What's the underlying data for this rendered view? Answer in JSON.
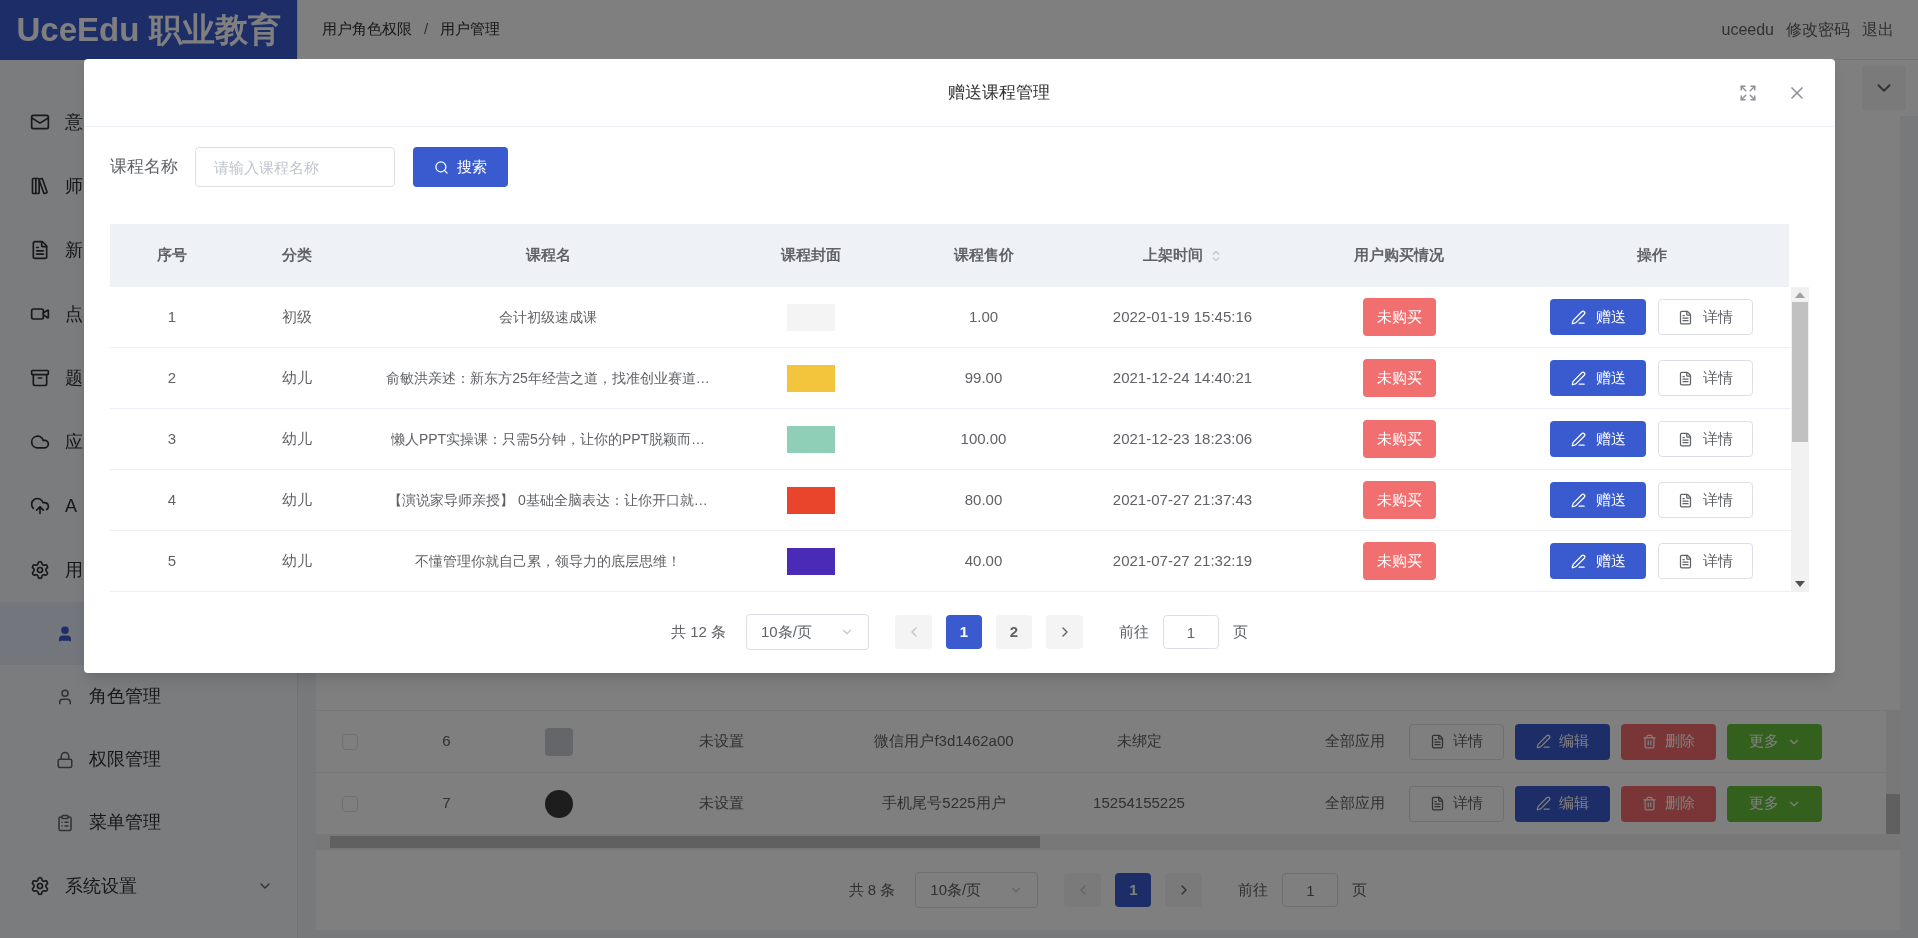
{
  "sidebar": {
    "logo": "UceEdu 职业教育",
    "items": [
      {
        "label": "意"
      },
      {
        "label": "师"
      },
      {
        "label": "新"
      },
      {
        "label": "点"
      },
      {
        "label": "题"
      },
      {
        "label": "应"
      },
      {
        "label": "A"
      },
      {
        "label": "用",
        "expanded": true,
        "children": [
          {
            "selected": true
          },
          {
            "label": "角色管理",
            "selected": false
          },
          {
            "label": "权限管理",
            "selected": false
          },
          {
            "label": "菜单管理",
            "selected": false
          }
        ]
      },
      {
        "label": "系统设置",
        "expanded": false
      }
    ]
  },
  "header": {
    "breadcrumb": [
      "用户角色权限",
      "用户管理"
    ],
    "separator": "/",
    "links": [
      "uceedu",
      "修改密码",
      "退出"
    ]
  },
  "user_table": {
    "rows": [
      {
        "checked": false,
        "index": "6",
        "role": "未设置",
        "nickname": "微信用户f3d1462a00",
        "phone": "未绑定",
        "app": "全部应用",
        "actions": [
          "详情",
          "编辑",
          "删除",
          "更多"
        ]
      },
      {
        "checked": false,
        "index": "7",
        "role": "未设置",
        "nickname": "手机尾号5225用户",
        "phone": "15254155225",
        "app": "全部应用",
        "actions": [
          "详情",
          "编辑",
          "删除",
          "更多"
        ]
      }
    ],
    "pagination": {
      "total": "共 8 条",
      "page_size": "10条/页",
      "pages": [
        {
          "label": "1",
          "selected": true
        }
      ],
      "goto_label": "前往",
      "goto_value": "1",
      "goto_suffix": "页"
    }
  },
  "modal": {
    "title": "赠送课程管理",
    "search": {
      "label": "课程名称",
      "placeholder": "请输入课程名称",
      "button": "搜索"
    },
    "table": {
      "columns": [
        {
          "label": "序号",
          "sortable": false
        },
        {
          "label": "分类",
          "sortable": false
        },
        {
          "label": "课程名",
          "sortable": false
        },
        {
          "label": "课程封面",
          "sortable": false
        },
        {
          "label": "课程售价",
          "sortable": false
        },
        {
          "label": "上架时间",
          "sortable": true
        },
        {
          "label": "用户购买情况",
          "sortable": false
        },
        {
          "label": "操作",
          "sortable": false
        }
      ],
      "rows": [
        {
          "index": "1",
          "category": "初级",
          "name": "会计初级速成课",
          "cover": {
            "color": "#f4f4f4"
          },
          "price": "1.00",
          "time": "2022-01-19 15:45:16",
          "status": "未购买",
          "actions": [
            "赠送",
            "详情"
          ]
        },
        {
          "index": "2",
          "category": "幼儿",
          "name": "俞敏洪亲述：新东方25年经营之道，找准创业赛道…",
          "cover": {
            "color": "#f2c53d"
          },
          "price": "99.00",
          "time": "2021-12-24 14:40:21",
          "status": "未购买",
          "actions": [
            "赠送",
            "详情"
          ]
        },
        {
          "index": "3",
          "category": "幼儿",
          "name": "懒人PPT实操课：只需5分钟，让你的PPT脱颖而…",
          "cover": {
            "color": "#8fcfb8"
          },
          "price": "100.00",
          "time": "2021-12-23 18:23:06",
          "status": "未购买",
          "actions": [
            "赠送",
            "详情"
          ]
        },
        {
          "index": "4",
          "category": "幼儿",
          "name": "【演说家导师亲授】 0基础全脑表达：让你开口就…",
          "cover": {
            "color": "#e8452c"
          },
          "price": "80.00",
          "time": "2021-07-27 21:37:43",
          "status": "未购买",
          "actions": [
            "赠送",
            "详情"
          ]
        },
        {
          "index": "5",
          "category": "幼儿",
          "name": "不懂管理你就自己累，领导力的底层思维！",
          "cover": {
            "color": "#4a2bb8"
          },
          "price": "40.00",
          "time": "2021-07-27 21:32:19",
          "status": "未购买",
          "actions": [
            "赠送",
            "详情"
          ]
        }
      ]
    },
    "pagination": {
      "total": "共 12 条",
      "page_size": "10条/页",
      "pages": [
        {
          "label": "1",
          "selected": true
        },
        {
          "label": "2",
          "selected": false
        }
      ],
      "goto_label": "前往",
      "goto_value": "1",
      "goto_suffix": "页"
    }
  }
}
